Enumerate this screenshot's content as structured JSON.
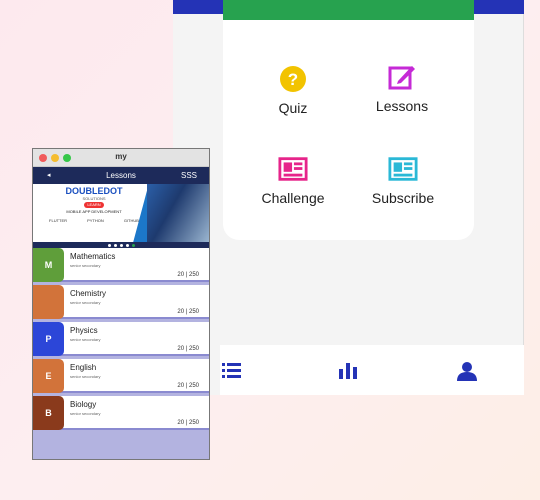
{
  "main": {
    "tiles": [
      {
        "label": "Quiz",
        "icon": "help-circle-icon",
        "color": "#f2c300"
      },
      {
        "label": "Lessons",
        "icon": "edit-note-icon",
        "color": "#c52ad6"
      },
      {
        "label": "Challenge",
        "icon": "news-icon",
        "color": "#e6248a"
      },
      {
        "label": "Subscribe",
        "icon": "news-icon",
        "color": "#2ab8d6"
      }
    ],
    "nav": [
      {
        "icon": "list-icon"
      },
      {
        "icon": "bar-chart-icon"
      },
      {
        "icon": "user-icon"
      }
    ],
    "colors": {
      "accent": "#2433b6",
      "green": "#27a24f"
    }
  },
  "mini": {
    "window_title": "my",
    "app_title": "Lessons",
    "back": "◂",
    "right_label": "SSS",
    "banner": {
      "title": "DOUBLEDOT",
      "subtitle": "SOLUTIONS",
      "learn": "LEARN",
      "course": "MOBILE APP DEVELOPMENT",
      "logos": [
        "FLUTTER",
        "PYTHON",
        "GITHUB"
      ]
    },
    "lessons": [
      {
        "letter": "M",
        "name": "Mathematics",
        "level": "senior secondary",
        "score": "20 | 250",
        "color": "#5f9e3a"
      },
      {
        "letter": "",
        "name": "Chemistry",
        "level": "senior secondary",
        "score": "20 | 250",
        "color": "#d2733a"
      },
      {
        "letter": "P",
        "name": "Physics",
        "level": "senior secondary",
        "score": "20 | 250",
        "color": "#2c46d8"
      },
      {
        "letter": "E",
        "name": "English",
        "level": "senior secondary",
        "score": "20 | 250",
        "color": "#d2733a"
      },
      {
        "letter": "B",
        "name": "Biology",
        "level": "senior secondary",
        "score": "20 | 250",
        "color": "#8a3a1c"
      }
    ]
  }
}
